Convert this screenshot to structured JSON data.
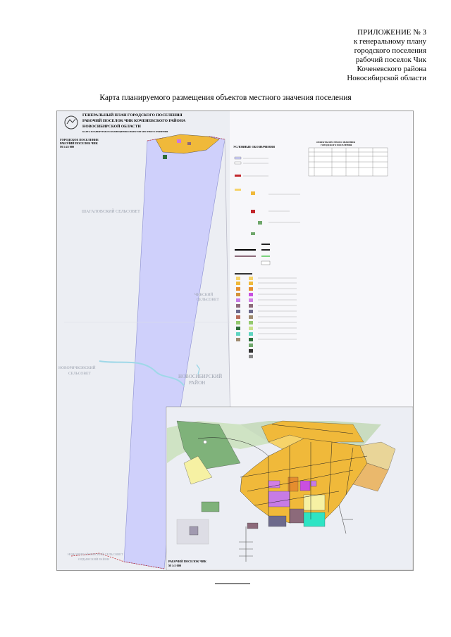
{
  "appendix": {
    "lines": [
      "ПРИЛОЖЕНИЕ № 3",
      "к генеральному плану",
      "городского поселения",
      "рабочий поселок Чик",
      "Коченевского района",
      "Новосибирской области"
    ]
  },
  "caption": "Карта планируемого размещения объектов местного значения поселения",
  "sheet": {
    "title_lines": [
      "ГЕНЕРАЛЬНЫЙ ПЛАН ГОРОДСКОГО ПОСЕЛЕНИЯ",
      "РАБОЧИЙ ПОСЕЛОК ЧИК КОЧЕНЕВСКОГО РАЙОНА",
      "НОВОСИБИРСКОЙ ОБЛАСТИ"
    ],
    "map_title_label": "КАРТА ПЛАНИРУЕМОГО РАЗМЕЩЕНИЯ ОБЪЕКТОВ МЕСТНОГО ЗНАЧЕНИЯ",
    "inset_label": [
      "ГОРОДСКОЕ ПОСЕЛЕНИЕ",
      "РАБОЧИЙ ПОСЕЛОК ЧИК",
      "М 1:25 000"
    ],
    "legend_title": "УСЛОВНЫЕ ОБОЗНАЧЕНИЯ",
    "table_title": [
      "ОБЪЕКТЫ МЕСТНОГО ЗНАЧЕНИЯ",
      "ГОРОДСКОГО ПОСЕЛЕНИЯ"
    ],
    "neighbors": {
      "west": "ШАГАЛОВСКИЙ СЕЛЬСОВЕТ",
      "east": [
        "ЧИКСКИЙ",
        "СЕЛЬСОВЕТ"
      ],
      "southwest": [
        "НОВОРИЧКОВСКИЙ",
        "СЕЛЬСОВЕТ"
      ],
      "district": [
        "НОВОСИБИРСКИЙ",
        "РАЙОН"
      ],
      "south": [
        "НОВОМИХАЙЛОВСКИЙ СЕЛЬСОВЕТ",
        "ОРДЫНСКИЙ РАЙОН"
      ]
    },
    "detail_label": [
      "РАБОЧИЙ ПОСЕЛОК ЧИК",
      "М 1:5 000"
    ],
    "colors": {
      "territory": "#cfd0fb",
      "residential": "#f0b93a",
      "residential_alt": "#f6d36a",
      "public": "#c77be6",
      "industrial": "#8c6a7a",
      "green": "#6fa76b",
      "water": "#9fd8e8",
      "boundary": "#c2272d",
      "neighbors": "#e3e4ec"
    }
  }
}
